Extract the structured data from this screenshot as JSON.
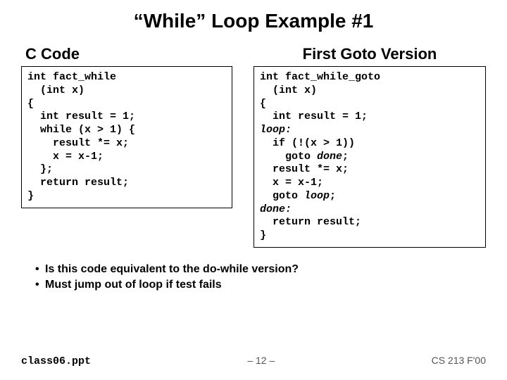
{
  "title": "“While” Loop Example #1",
  "left": {
    "heading": "C Code",
    "code_plain": "int fact_while\n  (int x)\n{\n  int result = 1;\n  while (x > 1) {\n    result *= x;\n    x = x-1;\n  };\n  return result;\n}"
  },
  "right": {
    "heading": "First Goto Version",
    "code_pre1": "int fact_while_goto\n  (int x)\n{\n  int result = 1;\n",
    "code_loop_label": "loop:",
    "code_mid1": "\n  if (!(x > 1))\n    goto ",
    "code_done_ref": "done",
    "code_mid2": ";\n  result *= x;\n  x = x-1;\n  goto ",
    "code_loop_ref": "loop",
    "code_mid3": ";\n",
    "code_done_label": "done:",
    "code_post": "\n  return result;\n}"
  },
  "bullets": [
    "Is this code equivalent to the do-while version?",
    "Must jump out of loop if test fails"
  ],
  "footer": {
    "file": "class06.ppt",
    "page": "– 12 –",
    "course": "CS 213 F'00"
  }
}
